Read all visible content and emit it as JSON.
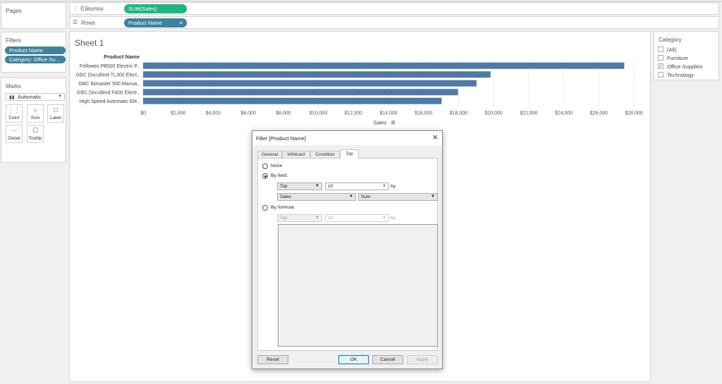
{
  "pages": {
    "title": "Pages"
  },
  "filters": {
    "title": "Filters",
    "pills": [
      "Product Name",
      "Category: Office Sup..."
    ],
    "pill_color": "#3f829b"
  },
  "marks": {
    "title": "Marks",
    "mark_type": "Automatic",
    "buttons": [
      "Color",
      "Size",
      "Label",
      "Detail",
      "Tooltip"
    ]
  },
  "shelves": {
    "columns_label": "Columns",
    "columns_pill": "SUM(Sales)",
    "columns_pill_color": "#1fb584",
    "rows_label": "Rows",
    "rows_pill": "Product Name",
    "rows_pill_color": "#3f829b"
  },
  "sheet": {
    "title": "Sheet 1"
  },
  "category": {
    "title": "Category",
    "items": [
      {
        "label": "(All)",
        "checked": false
      },
      {
        "label": "Furniture",
        "checked": false
      },
      {
        "label": "Office Supplies",
        "checked": true
      },
      {
        "label": "Technology",
        "checked": false
      }
    ]
  },
  "chart_data": {
    "type": "bar",
    "orientation": "horizontal",
    "row_header": "Product Name",
    "categories": [
      "Fellowes PB500 Electric P..",
      "GBC DocuBind TL300 Elect..",
      "GBC Ibimaster 500 Manua..",
      "GBC DocuBind P400 Electr..",
      "High Speed Automatic Ele.."
    ],
    "values": [
      27453,
      19823,
      19024,
      17965,
      17030
    ],
    "xlabel": "Sales",
    "xlim": [
      0,
      28000
    ],
    "ticks": [
      "$0",
      "$2,000",
      "$4,000",
      "$6,000",
      "$8,000",
      "$10,000",
      "$12,000",
      "$14,000",
      "$16,000",
      "$18,000",
      "$20,000",
      "$22,000",
      "$24,000",
      "$26,000",
      "$28,000"
    ],
    "bar_color": "#4e79a7",
    "grid": true
  },
  "dialog": {
    "title": "Filter [Product Name]",
    "tabs": [
      "General",
      "Wildcard",
      "Condition",
      "Top"
    ],
    "active_tab": "Top",
    "none_label": "None",
    "by_field_label": "By field:",
    "by_field_direction": "Top",
    "by_field_count": "10",
    "by_word": "by",
    "by_field_measure": "Sales",
    "by_field_aggregation": "Sum",
    "by_formula_label": "By formula:",
    "by_formula_direction": "Top",
    "by_formula_count": "10",
    "reset_label": "Reset",
    "ok_label": "OK",
    "cancel_label": "Cancel",
    "apply_label": "Apply"
  }
}
